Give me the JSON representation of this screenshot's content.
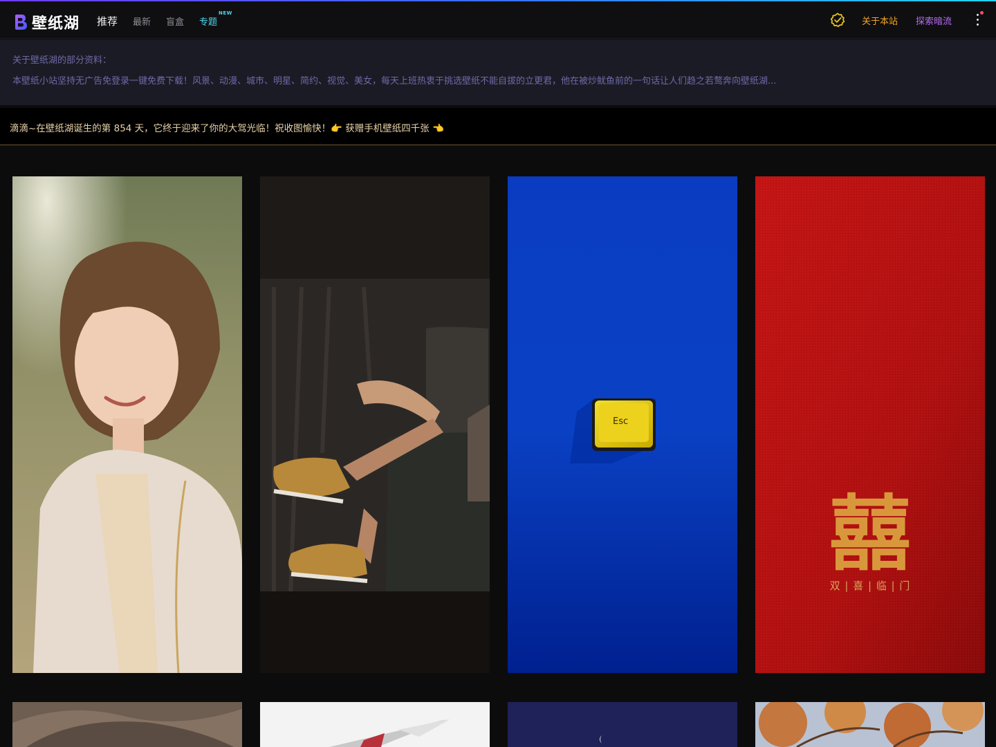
{
  "site": {
    "logo_text": "壁纸湖"
  },
  "nav": {
    "items": [
      {
        "label": "推荐",
        "active": true
      },
      {
        "label": "最新",
        "active": false
      },
      {
        "label": "盲盒",
        "active": false
      },
      {
        "label": "专题",
        "active": false,
        "badge": "NEW"
      }
    ]
  },
  "right_nav": {
    "about": "关于本站",
    "explore": "探索暗流"
  },
  "info": {
    "title": "关于壁纸湖的部分资料：",
    "description": "本壁纸小站坚持无广告免登录一键免费下载！风景、动漫、城市、明星、简约、视觉、美女，每天上班热衷于挑选壁纸不能自拔的立更君，他在被炒鱿鱼前的一句话让人们趋之若鹜奔向壁纸湖..."
  },
  "welcome": {
    "text": "滴滴~在壁纸湖诞生的第 854 天，它终于迎来了你的大驾光临！祝收图愉快！👉 获赠手机壁纸四千张 👈"
  },
  "wallpapers": [
    {
      "name": "portrait-woman",
      "keycap_label": "",
      "caption": ""
    },
    {
      "name": "sneakers-legs",
      "keycap_label": "",
      "caption": ""
    },
    {
      "name": "esc-key",
      "keycap_label": "Esc",
      "caption": ""
    },
    {
      "name": "double-happiness",
      "keycap_label": "",
      "caption": "囍",
      "subcaption": "双 | 喜 | 临 | 门"
    }
  ],
  "colors": {
    "accent_cyan": "#4dd8f0",
    "accent_orange": "#f5a524",
    "accent_purple": "#b46cf0",
    "info_text": "#6e6aa6",
    "welcome_text": "#e8d2a8"
  }
}
